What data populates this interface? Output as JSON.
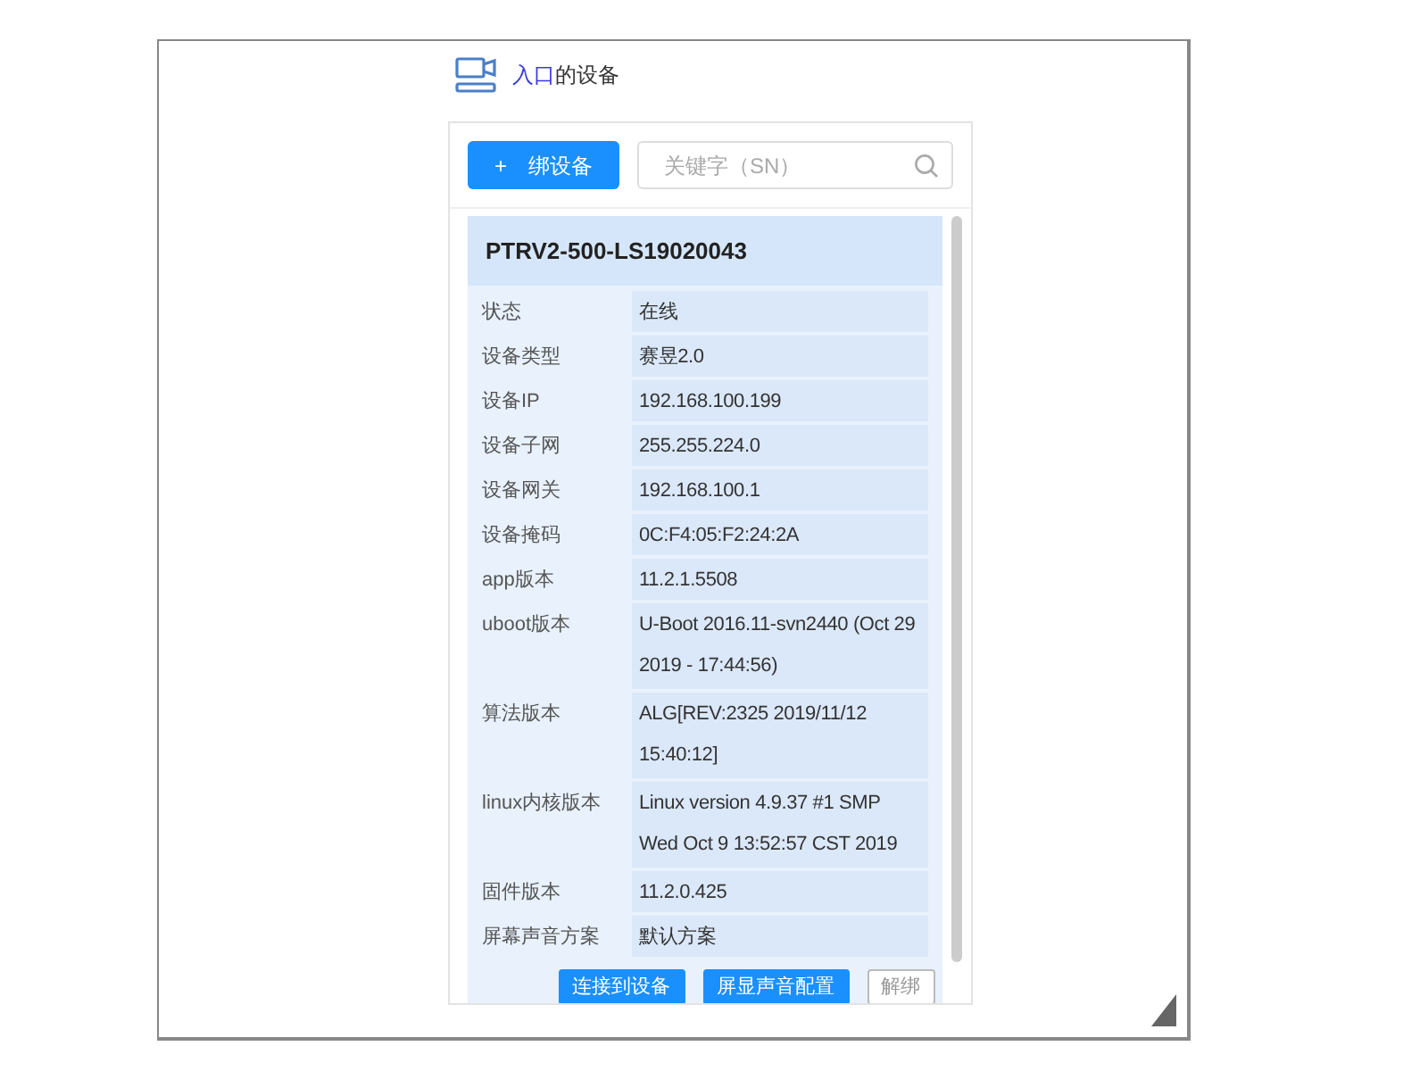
{
  "header": {
    "link": "入口",
    "text": "的设备"
  },
  "toolbar": {
    "add_button": {
      "icon": "+",
      "label": "绑设备"
    },
    "search": {
      "placeholder": "关键字（SN）"
    }
  },
  "device": {
    "name": "PTRV2-500-LS19020043",
    "fields": [
      {
        "label": "状态",
        "value": "在线"
      },
      {
        "label": "设备类型",
        "value": "赛昱2.0"
      },
      {
        "label": "设备IP",
        "value": "192.168.100.199"
      },
      {
        "label": "设备子网",
        "value": "255.255.224.0"
      },
      {
        "label": "设备网关",
        "value": "192.168.100.1"
      },
      {
        "label": "设备掩码",
        "value": "0C:F4:05:F2:24:2A"
      },
      {
        "label": "app版本",
        "value": "11.2.1.5508"
      },
      {
        "label": "uboot版本",
        "value": "U-Boot 2016.11-svn2440 (Oct 29 2019 - 17:44:56)"
      },
      {
        "label": "算法版本",
        "value": "ALG[REV:2325 2019/11/12 15:40:12]"
      },
      {
        "label": "linux内核版本",
        "value": "Linux version 4.9.37  #1 SMP Wed Oct 9 13:52:57 CST 2019"
      },
      {
        "label": "固件版本",
        "value": "11.2.0.425"
      },
      {
        "label": "屏幕声音方案",
        "value": "默认方案"
      }
    ]
  },
  "actions": [
    {
      "label": "连接到设备",
      "kind": "primary"
    },
    {
      "label": "屏显声音配置",
      "kind": "primary"
    },
    {
      "label": "解绑",
      "kind": "outline"
    }
  ]
}
